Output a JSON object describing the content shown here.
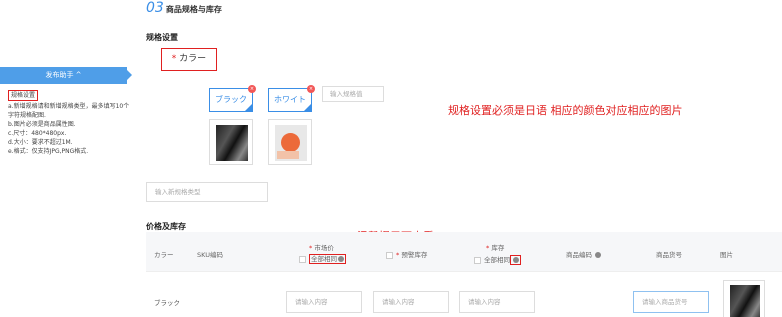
{
  "sidebar": {
    "help_header": "发布助手 ^",
    "items": [
      "规格设置",
      "a.新增规格请和新增规格类型，最多填写10个字符规格配图.",
      "b.图片必须是商品属性图.",
      "c.尺寸：480*480px.",
      "d.大小：要求不超过1M.",
      "e.格式：仅支持JPG,PNG格式."
    ]
  },
  "section": {
    "number": "03",
    "title": "商品规格与库存"
  },
  "spec": {
    "title": "规格设置",
    "type_label": "カラー",
    "values": [
      "ブラック",
      "ホワイト"
    ],
    "remove_glyph": "×",
    "new_value_placeholder": "输入规格值",
    "new_type_placeholder": "输入新规格类型"
  },
  "annotations": {
    "spec_note": "规格设置必须是日语  相应的颜色对应相应的图片",
    "tip_note": "温馨提示可查看"
  },
  "price": {
    "title": "价格及库存",
    "headers": {
      "color": "カラー",
      "sku": "SKU编码",
      "market_price": "市场价",
      "same_all": "全部相同",
      "warning_stock": "预警库存",
      "stock": "库存",
      "product_code": "商品编码",
      "product_no": "商品货号",
      "image": "图片"
    },
    "row": {
      "color": "ブラック",
      "input_placeholder": "请输入内容",
      "product_no_placeholder": "请输入商品货号"
    }
  },
  "colors": {
    "accent": "#3a8ee6",
    "alert": "#e02020",
    "help_bar": "#4f9ee8"
  }
}
